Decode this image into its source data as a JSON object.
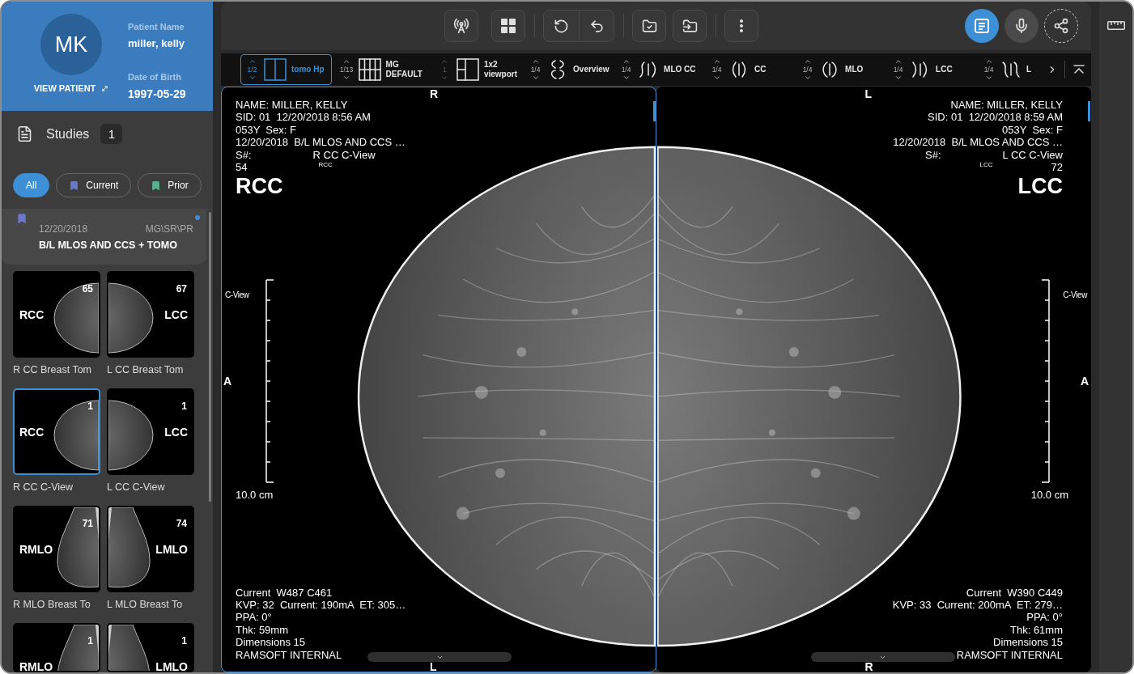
{
  "patient": {
    "initials": "MK",
    "link": "VIEW PATIENT",
    "name_label": "Patient Name",
    "name": "miller, kelly",
    "dob_label": "Date of Birth",
    "dob": "1997-05-29"
  },
  "studies_header": {
    "title": "Studies",
    "count": "1"
  },
  "filters": [
    {
      "label": "All",
      "selected": true
    },
    {
      "label": "Current",
      "selected": false,
      "color": "#6b78c6"
    },
    {
      "label": "Prior",
      "selected": false,
      "color": "#58b08e"
    }
  ],
  "study_list": [
    {
      "date": "12/20/2018",
      "modality": "MG\\SR\\PR",
      "description": "B/L MLOS AND CCS + TOMO",
      "color": "#6b78c6",
      "unread": true
    }
  ],
  "thumbnails": [
    {
      "kind": "rcc",
      "number": "65",
      "view": "RCC",
      "caption": "R CC Breast Tom",
      "selected": false
    },
    {
      "kind": "lcc",
      "number": "67",
      "view": "LCC",
      "caption": "L CC Breast Tom",
      "selected": false
    },
    {
      "kind": "rcc",
      "number": "1",
      "view": "RCC",
      "caption": "R CC C-View",
      "selected": true
    },
    {
      "kind": "lcc",
      "number": "1",
      "view": "LCC",
      "caption": "L CC C-View",
      "selected": false
    },
    {
      "kind": "rmlo",
      "number": "71",
      "view": "RMLO",
      "caption": "R MLO Breast To",
      "selected": false
    },
    {
      "kind": "lmlo",
      "number": "74",
      "view": "LMLO",
      "caption": "L MLO Breast To",
      "selected": false
    },
    {
      "kind": "rmlo",
      "number": "1",
      "view": "RMLO",
      "selected": false
    },
    {
      "kind": "lmlo",
      "number": "1",
      "view": "LMLO",
      "selected": false
    }
  ],
  "actions": [
    {
      "kind": "report",
      "active": true
    },
    {
      "kind": "dictation",
      "active": false
    },
    {
      "kind": "share",
      "active": false
    }
  ],
  "protocols": [
    {
      "kind": "two-pane",
      "counter": "1/2",
      "lines": [
        "tomo Hp"
      ],
      "selected": true,
      "disabled": false
    },
    {
      "kind": "grid",
      "counter": "1/13",
      "lines": [
        "MG",
        "DEFAULT"
      ],
      "selected": false,
      "disabled": false
    },
    {
      "kind": "split",
      "counter": "1",
      "lines": [
        "1x2",
        "viewport"
      ],
      "selected": false,
      "disabled": true
    },
    {
      "kind": "overview",
      "counter": "1/4",
      "lines": [
        "Overview"
      ],
      "selected": false,
      "disabled": false
    },
    {
      "kind": "mlo-cc",
      "counter": "1/4",
      "lines": [
        "MLO CC"
      ],
      "selected": false,
      "disabled": false
    },
    {
      "kind": "cc",
      "counter": "1/4",
      "lines": [
        "CC"
      ],
      "selected": false,
      "disabled": false
    },
    {
      "kind": "mlo",
      "counter": "1/4",
      "lines": [
        "MLO"
      ],
      "selected": false,
      "disabled": false
    },
    {
      "kind": "lcc",
      "counter": "1/4",
      "lines": [
        "LCC"
      ],
      "selected": false,
      "disabled": false
    },
    {
      "kind": "lmlo",
      "counter": "1/4",
      "lines": [
        "L"
      ],
      "selected": false,
      "disabled": false
    }
  ],
  "viewports": [
    {
      "kind": "rcc",
      "selected": true,
      "top_marker": "R",
      "side_marker": "A",
      "bottom_marker": "L",
      "top_lines": [
        "NAME: MILLER, KELLY",
        "SID: 01  12/20/2018 8:56 AM",
        "053Y  Sex: F",
        "12/20/2018  B/L MLOS AND CCS …"
      ],
      "series": {
        "label": "S#:",
        "view": "R CC C-View",
        "mini": "RCC"
      },
      "image_number": "54",
      "view": "RCC",
      "scale_label": "C-View",
      "scale": "10.0 cm",
      "bottom_lines": [
        "Current  W487 C461",
        "KVP: 32  Current: 190mA  ET: 305…",
        "PPA: 0°",
        "Thk: 59mm",
        "Dimensions 15",
        "RAMSOFT INTERNAL"
      ]
    },
    {
      "kind": "lcc",
      "selected": false,
      "top_marker": "L",
      "side_marker": "A",
      "bottom_marker": "R",
      "top_lines": [
        "NAME: MILLER, KELLY",
        "SID: 01  12/20/2018 8:59 AM",
        "053Y  Sex: F",
        "12/20/2018  B/L MLOS AND CCS …"
      ],
      "series": {
        "label": "S#:",
        "view": "L CC C-View",
        "mini": "LCC"
      },
      "image_number": "72",
      "view": "LCC",
      "scale_label": "C-View",
      "scale": "10.0 cm",
      "bottom_lines": [
        "Current  W390 C449",
        "KVP: 33  Current: 200mA  ET: 279…",
        "PPA: 0°",
        "Thk: 61mm",
        "Dimensions 15",
        "RAMSOFT INTERNAL"
      ]
    }
  ]
}
